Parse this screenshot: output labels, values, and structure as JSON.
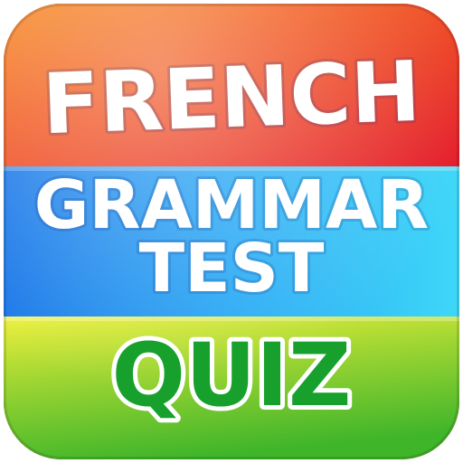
{
  "app_icon": {
    "title_line_1": "FRENCH",
    "title_line_2": "GRAMMAR",
    "title_line_3": "TEST",
    "title_line_4": "QUIZ"
  },
  "colors": {
    "top_band_orange": "#f46d1b",
    "top_band_red": "#e8202a",
    "middle_band_blue": "#1e90f0",
    "middle_band_cyan": "#37d3f6",
    "bottom_band_yellow": "#e6ee2e",
    "bottom_band_green": "#49c12a",
    "text_white": "#ffffff",
    "text_green": "#17a02c",
    "text_outline": "#ffffff",
    "text_shadow": "#1b3b8c"
  }
}
